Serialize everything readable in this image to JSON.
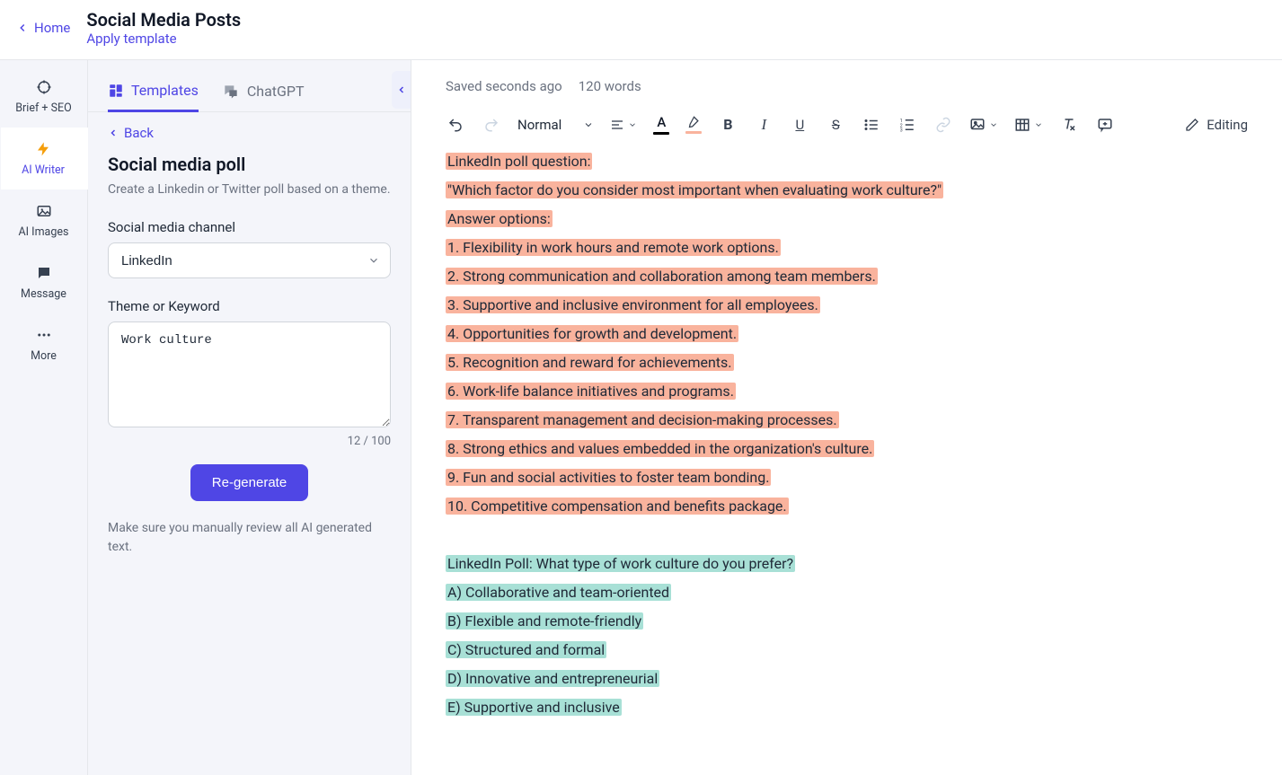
{
  "header": {
    "home": "Home",
    "title": "Social Media Posts",
    "apply_template": "Apply template"
  },
  "rail": {
    "items": [
      {
        "label": "Brief + SEO",
        "icon": "crosshair-icon"
      },
      {
        "label": "AI Writer",
        "icon": "bolt-icon"
      },
      {
        "label": "AI Images",
        "icon": "image-icon"
      },
      {
        "label": "Message",
        "icon": "chat-icon"
      },
      {
        "label": "More",
        "icon": "more-icon"
      }
    ],
    "active_index": 1
  },
  "panel": {
    "tabs": [
      {
        "label": "Templates",
        "icon": "templates-icon"
      },
      {
        "label": "ChatGPT",
        "icon": "chatgpt-icon"
      }
    ],
    "active_tab_index": 0,
    "back": "Back",
    "title": "Social media poll",
    "subtitle": "Create a Linkedin or Twitter poll based on a theme.",
    "channel_label": "Social media channel",
    "channel_value": "LinkedIn",
    "theme_label": "Theme or Keyword",
    "theme_value": "Work culture",
    "char_count": "12 / 100",
    "regenerate": "Re-generate",
    "note": "Make sure you manually review all AI generated text."
  },
  "editor": {
    "saved": "Saved seconds ago",
    "word_count": "120 words",
    "format_label": "Normal",
    "editing_label": "Editing",
    "font_color": "#000000",
    "highlight_color": "#f9b39d",
    "doc_orange": [
      "LinkedIn poll question:",
      "\"Which factor do you consider most important when evaluating work culture?\"",
      "Answer options:",
      "1. Flexibility in work hours and remote work options.",
      "2. Strong communication and collaboration among team members.",
      "3. Supportive and inclusive environment for all employees.",
      "4. Opportunities for growth and development.",
      "5. Recognition and reward for achievements.",
      "6. Work-life balance initiatives and programs.",
      "7. Transparent management and decision-making processes.",
      "8. Strong ethics and values embedded in the organization's culture.",
      "9. Fun and social activities to foster team bonding.",
      "10. Competitive compensation and benefits package."
    ],
    "doc_teal": [
      "LinkedIn Poll: What type of work culture do you prefer?",
      "A) Collaborative and team-oriented",
      "B) Flexible and remote-friendly",
      "C) Structured and formal",
      "D) Innovative and entrepreneurial",
      "E) Supportive and inclusive"
    ]
  }
}
